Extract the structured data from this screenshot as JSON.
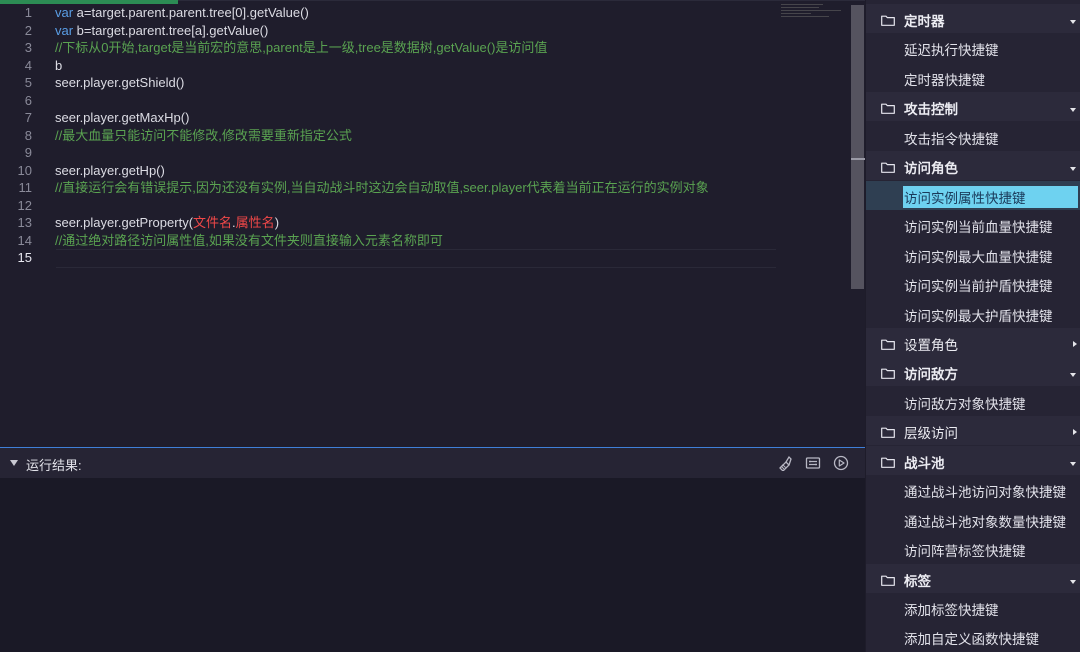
{
  "editor": {
    "lines": [
      {
        "n": "1",
        "parts": [
          [
            "kw",
            "var"
          ],
          [
            "t",
            " a=target.parent.parent.tree[0].getValue()"
          ]
        ]
      },
      {
        "n": "2",
        "parts": [
          [
            "kw",
            "var"
          ],
          [
            "t",
            " b=target.parent.tree[a].getValue()"
          ]
        ]
      },
      {
        "n": "3",
        "parts": [
          [
            "cm",
            "//下标从0开始,target是当前宏的意思,parent是上一级,tree是数据树,getValue()是访问值"
          ]
        ]
      },
      {
        "n": "4",
        "parts": [
          [
            "t",
            "b"
          ]
        ]
      },
      {
        "n": "5",
        "parts": [
          [
            "t",
            "seer.player.getShield()"
          ]
        ]
      },
      {
        "n": "6",
        "parts": []
      },
      {
        "n": "7",
        "parts": [
          [
            "t",
            "seer.player.getMaxHp()"
          ]
        ]
      },
      {
        "n": "8",
        "parts": [
          [
            "cm",
            "//最大血量只能访问不能修改,修改需要重新指定公式"
          ]
        ]
      },
      {
        "n": "9",
        "parts": []
      },
      {
        "n": "10",
        "parts": [
          [
            "t",
            "seer.player.getHp()"
          ]
        ]
      },
      {
        "n": "11",
        "parts": [
          [
            "cm",
            "//直接运行会有错误提示,因为还没有实例,当自动战斗时这边会自动取值,seer.player代表着当前正在运行的实例对象"
          ]
        ]
      },
      {
        "n": "12",
        "parts": []
      },
      {
        "n": "13",
        "parts": [
          [
            "t",
            "seer.player.getProperty("
          ],
          [
            "str",
            "文件名"
          ],
          [
            "t",
            "."
          ],
          [
            "str",
            "属性名"
          ],
          [
            "t",
            ")"
          ]
        ]
      },
      {
        "n": "14",
        "parts": [
          [
            "cm",
            "//通过绝对路径访问属性值,如果没有文件夹则直接输入元素名称即可"
          ]
        ]
      },
      {
        "n": "15",
        "parts": [],
        "active": true
      }
    ]
  },
  "output": {
    "title": "运行结果:",
    "icons": [
      "clear-icon",
      "console-icon",
      "run-icon"
    ]
  },
  "sidebar": {
    "rows": [
      {
        "type": "group",
        "label": "定时器",
        "open": true
      },
      {
        "type": "item",
        "label": "延迟执行快捷键"
      },
      {
        "type": "item",
        "label": "定时器快捷键"
      },
      {
        "type": "group",
        "label": "攻击控制",
        "open": true
      },
      {
        "type": "item",
        "label": "攻击指令快捷键"
      },
      {
        "type": "group",
        "label": "访问角色",
        "open": true
      },
      {
        "type": "item",
        "label": "访问实例属性快捷键",
        "selected": true
      },
      {
        "type": "item",
        "label": "访问实例当前血量快捷键"
      },
      {
        "type": "item",
        "label": "访问实例最大血量快捷键"
      },
      {
        "type": "item",
        "label": "访问实例当前护盾快捷键"
      },
      {
        "type": "item",
        "label": "访问实例最大护盾快捷键"
      },
      {
        "type": "group",
        "label": "设置角色",
        "open": false
      },
      {
        "type": "group",
        "label": "访问敌方",
        "open": true
      },
      {
        "type": "item",
        "label": "访问敌方对象快捷键"
      },
      {
        "type": "group",
        "label": "层级访问",
        "open": false
      },
      {
        "type": "group",
        "label": "战斗池",
        "open": true
      },
      {
        "type": "item",
        "label": "通过战斗池访问对象快捷键"
      },
      {
        "type": "item",
        "label": "通过战斗池对象数量快捷键"
      },
      {
        "type": "item",
        "label": "访问阵营标签快捷键"
      },
      {
        "type": "group",
        "label": "标签",
        "open": true
      },
      {
        "type": "item",
        "label": "添加标签快捷键"
      },
      {
        "type": "item",
        "label": "添加自定义函数快捷键"
      }
    ]
  },
  "colors": {
    "keyword": "#5a9ee6",
    "comment": "#5aa351",
    "string": "#f04848",
    "selection": "#6ed2f0"
  }
}
